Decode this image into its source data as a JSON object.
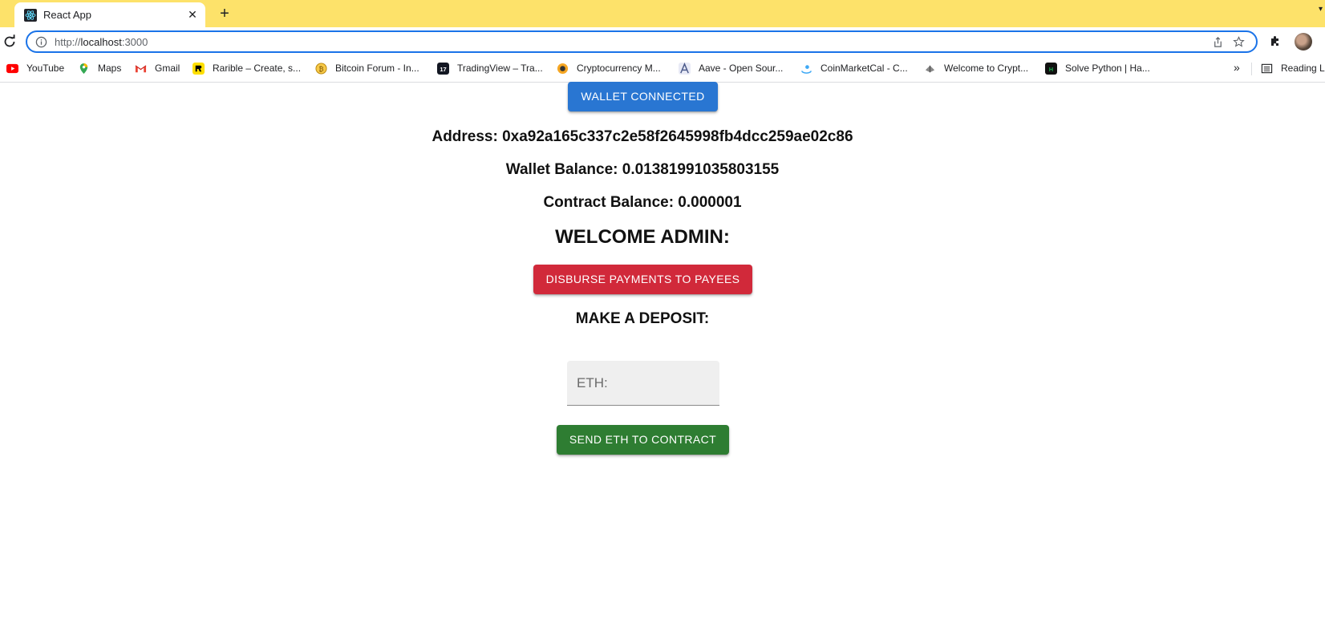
{
  "browser": {
    "tab": {
      "title": "React App",
      "favicon": "react-icon"
    },
    "url_prefix": "http://",
    "url_host": "localhost",
    "url_suffix": ":3000",
    "bookmarks": [
      {
        "label": "YouTube",
        "icon": "youtube-icon",
        "color": "#ff0000"
      },
      {
        "label": "Maps",
        "icon": "maps-icon",
        "color": "#34a853"
      },
      {
        "label": "Gmail",
        "icon": "gmail-icon",
        "color": "#ea4335"
      },
      {
        "label": "Rarible – Create, s...",
        "icon": "rarible-icon",
        "color": "#fedf00"
      },
      {
        "label": "Bitcoin Forum - In...",
        "icon": "bitcoin-icon",
        "color": "#f7c948"
      },
      {
        "label": "TradingView – Tra...",
        "icon": "tradingview-icon",
        "color": "#131722"
      },
      {
        "label": "Cryptocurrency M...",
        "icon": "coinmarketcap-icon",
        "color": "#f5a623"
      },
      {
        "label": "Aave - Open Sour...",
        "icon": "aave-icon",
        "color": "#4b5a8a"
      },
      {
        "label": "CoinMarketCal - C...",
        "icon": "coinmarketcal-icon",
        "color": "#3fa9f5"
      },
      {
        "label": "Welcome to Crypt...",
        "icon": "crypto-icon",
        "color": "#777777"
      },
      {
        "label": "Solve Python | Ha...",
        "icon": "hackerrank-icon",
        "color": "#1ba94c"
      }
    ],
    "more_bookmarks": "»",
    "reading_list": "Reading Li"
  },
  "page": {
    "wallet_button": "WALLET CONNECTED",
    "address_line": "Address: 0xa92a165c337c2e58f2645998fb4dcc259ae02c86",
    "wallet_balance_line": "Wallet Balance: 0.01381991035803155",
    "contract_balance_line": "Contract Balance: 0.000001",
    "welcome": "WELCOME ADMIN:",
    "disburse_button": "DISBURSE PAYMENTS TO PAYEES",
    "deposit_title": "MAKE A DEPOSIT:",
    "eth_placeholder": "ETH:",
    "send_button": "SEND ETH TO CONTRACT"
  },
  "colors": {
    "tabstrip": "#fde26a",
    "wallet_button": "#2976d2",
    "disburse_button": "#d1293a",
    "send_button": "#2e7d32"
  }
}
